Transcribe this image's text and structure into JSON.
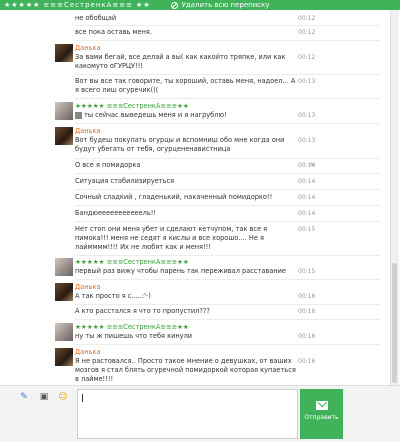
{
  "window": {
    "title_stars_left": "★★★★★",
    "title_name": "≡≡≡СестренкА≡≡≡",
    "title_stars_right": "★★",
    "delete_label": "Удалить всю переписку"
  },
  "messages": [
    {
      "text": "не обобщай",
      "time": "00:12"
    },
    {
      "text": "все пока оставь меня.",
      "time": "00:12"
    },
    {
      "author": "Данька",
      "text": "За вами бегай, все делай а вы( как какойто тряпке, или как какомуто оГУРЦУ!!!",
      "time": "00:12"
    },
    {
      "text": "Вот вы все так говорите, ты хороший, оставь меня, надоел... А я всего лиш огуречик(((",
      "time": "00:13"
    },
    {
      "author": "★★★★★ ≡≡≡СестренкА≡≡≡★★",
      "text": "ты сейчас выведешь меня и я нагрублю!",
      "time": "00:13"
    },
    {
      "author": "Данька",
      "text": "Вот будеш покупать огурцы и вспомниш обо мне когда они будут убегать от тебя, огурцененавистница",
      "time": "00:13"
    },
    {
      "text": "О все я помидорка",
      "time": "00:14"
    },
    {
      "text": "Ситуация стабилизируеться",
      "time": "00:14"
    },
    {
      "text": "Сочный сладкий , гладенький, накаченный помидорко!!",
      "time": "00:14"
    },
    {
      "text": "Бандюееееееееееель!!",
      "time": "00:14"
    },
    {
      "text": "Нет стоп они меня убет и сделают кетчупом, так все я пимока!!! меня не седят я кислы и все хорошо.... Не я лаймммм!!!! Их не любят как и меня!!!",
      "time": "00:15"
    },
    {
      "author": "★★★★★ ≡≡≡СестренкА≡≡≡★★",
      "text": "первый раз вижу чтобы парень так переживал расставание",
      "time": "00:15"
    },
    {
      "author": "Данька",
      "text": "А так просто я с.....:'-)",
      "time": "00:16"
    },
    {
      "text": "А кто расстался я что то пропустил???",
      "time": "00:16"
    },
    {
      "author": "★★★★★ ≡≡≡СестренкА≡≡≡★★",
      "text": "ну ты ж пишешь что тебя кинули",
      "time": "00:16"
    },
    {
      "author": "Данька",
      "text": "Я не растовался.. Просто такое мнение о девушках, от ваших мозгов я стал блять огуречной помидоркой которая купаеться в лайме!!!!",
      "time": "00:16"
    }
  ],
  "composer": {
    "value": "",
    "send_label": "Отправить"
  },
  "colors": {
    "accent": "#40b35a",
    "author_girl": "#3a9e3a",
    "author_boy": "#e06a1e"
  }
}
